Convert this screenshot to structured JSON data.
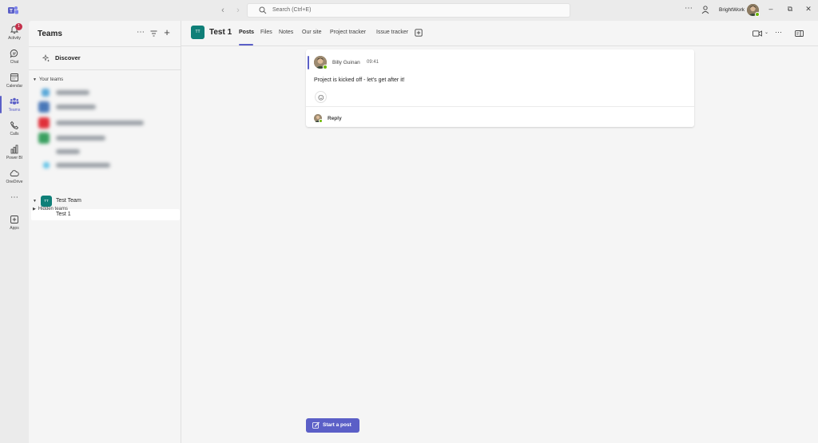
{
  "titlebar": {
    "search_placeholder": "Search (Ctrl+E)",
    "org_name": "BrightWork"
  },
  "appbar": {
    "items": [
      {
        "label": "Activity",
        "icon": "bell-icon",
        "badge": "1"
      },
      {
        "label": "Chat",
        "icon": "chat-icon"
      },
      {
        "label": "Calendar",
        "icon": "calendar-icon"
      },
      {
        "label": "Teams",
        "icon": "teams-icon",
        "active": true
      },
      {
        "label": "Calls",
        "icon": "phone-icon"
      },
      {
        "label": "Power BI",
        "icon": "power-bi-icon"
      },
      {
        "label": "OneDrive",
        "icon": "cloud-icon"
      },
      {
        "label": "Apps",
        "icon": "apps-icon"
      }
    ]
  },
  "sidebar": {
    "title": "Teams",
    "discover_label": "Discover",
    "your_teams_label": "Your teams",
    "team": {
      "initials": "TT",
      "name": "Test Team"
    },
    "channel": {
      "name": "Test 1"
    },
    "hidden_teams_label": "Hidden teams"
  },
  "main": {
    "team_initials": "TT",
    "channel_title": "Test 1",
    "tabs": [
      "Posts",
      "Files",
      "Notes",
      "Our site",
      "Project tracker",
      "Issue tracker"
    ],
    "active_tab": "Posts",
    "post": {
      "author": "Billy Guinan",
      "time": "09:41",
      "body": "Project is kicked off - let's get after it!",
      "reply_label": "Reply"
    },
    "start_post_label": "Start a post"
  },
  "colors": {
    "accent": "#5b5fc7",
    "team_avatar": "#0f7f78",
    "badge": "#c4314b",
    "presence": "#6bb700"
  }
}
